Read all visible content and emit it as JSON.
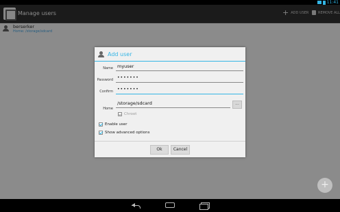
{
  "status_bar": {
    "time": "11:41"
  },
  "action_bar": {
    "title": "Manage users",
    "add_user_label": "ADD USER",
    "remove_all_label": "REMOVE ALL",
    "add_icon_glyph": "+"
  },
  "users": [
    {
      "name": "berserker",
      "home": "Home: /storage/sdcard"
    }
  ],
  "dialog": {
    "title": "Add user",
    "fields": {
      "name_label": "Name",
      "name_value": "myuser",
      "password_label": "Password",
      "password_value": "•••••••",
      "confirm_label": "Confirm",
      "confirm_value": "•••••••",
      "home_label": "Home",
      "home_value": "/storage/sdcard",
      "browse_label": "..."
    },
    "checkboxes": {
      "chroot_label": "Chroot",
      "chroot_checked": true,
      "chroot_enabled": false,
      "enable_user_label": "Enable user",
      "enable_user_checked": true,
      "advanced_label": "Show advanced options",
      "advanced_checked": true
    },
    "buttons": {
      "ok_label": "Ok",
      "cancel_label": "Cancel"
    }
  },
  "fab": {
    "icon": "plus-icon",
    "glyph": "+"
  },
  "colors": {
    "accent": "#33b5e5",
    "action_bar": "#2a2a2a",
    "background": "#d6d6d6"
  }
}
